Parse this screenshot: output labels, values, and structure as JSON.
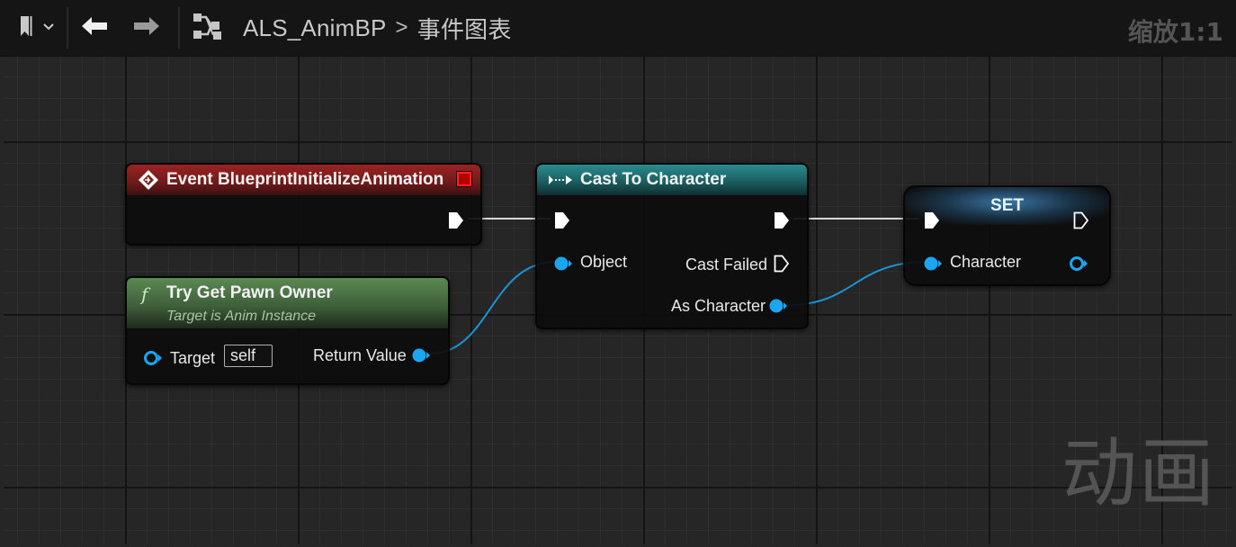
{
  "toolbar": {
    "bookmark_icon": "bookmark-icon",
    "back_icon": "arrow-left-icon",
    "forward_icon": "arrow-right-icon",
    "graph_icon": "graph-hierarchy-icon",
    "breadcrumb": [
      "ALS_AnimBP",
      "事件图表"
    ],
    "separator": ">",
    "zoom": "缩放1:1"
  },
  "watermark": "动画",
  "colors": {
    "event_header": "#8b1d1d",
    "function_header": "#4f7246",
    "cast_header": "#1e6f72",
    "set_header": "#2a5f82",
    "object_pin": "#00a8f2",
    "exec_pin": "#ffffff",
    "graph_bg": "#262626"
  },
  "nodes": {
    "event": {
      "title": "Event BlueprintInitializeAnimation"
    },
    "pawn_owner": {
      "title": "Try Get Pawn Owner",
      "subtitle": "Target is Anim Instance",
      "func_glyph": "f",
      "target_label": "Target",
      "target_value": "self",
      "return_label": "Return Value"
    },
    "cast": {
      "title": "Cast To Character",
      "object_label": "Object",
      "failed_label": "Cast Failed",
      "as_label": "As Character"
    },
    "set": {
      "title": "SET",
      "var_label": "Character"
    }
  }
}
